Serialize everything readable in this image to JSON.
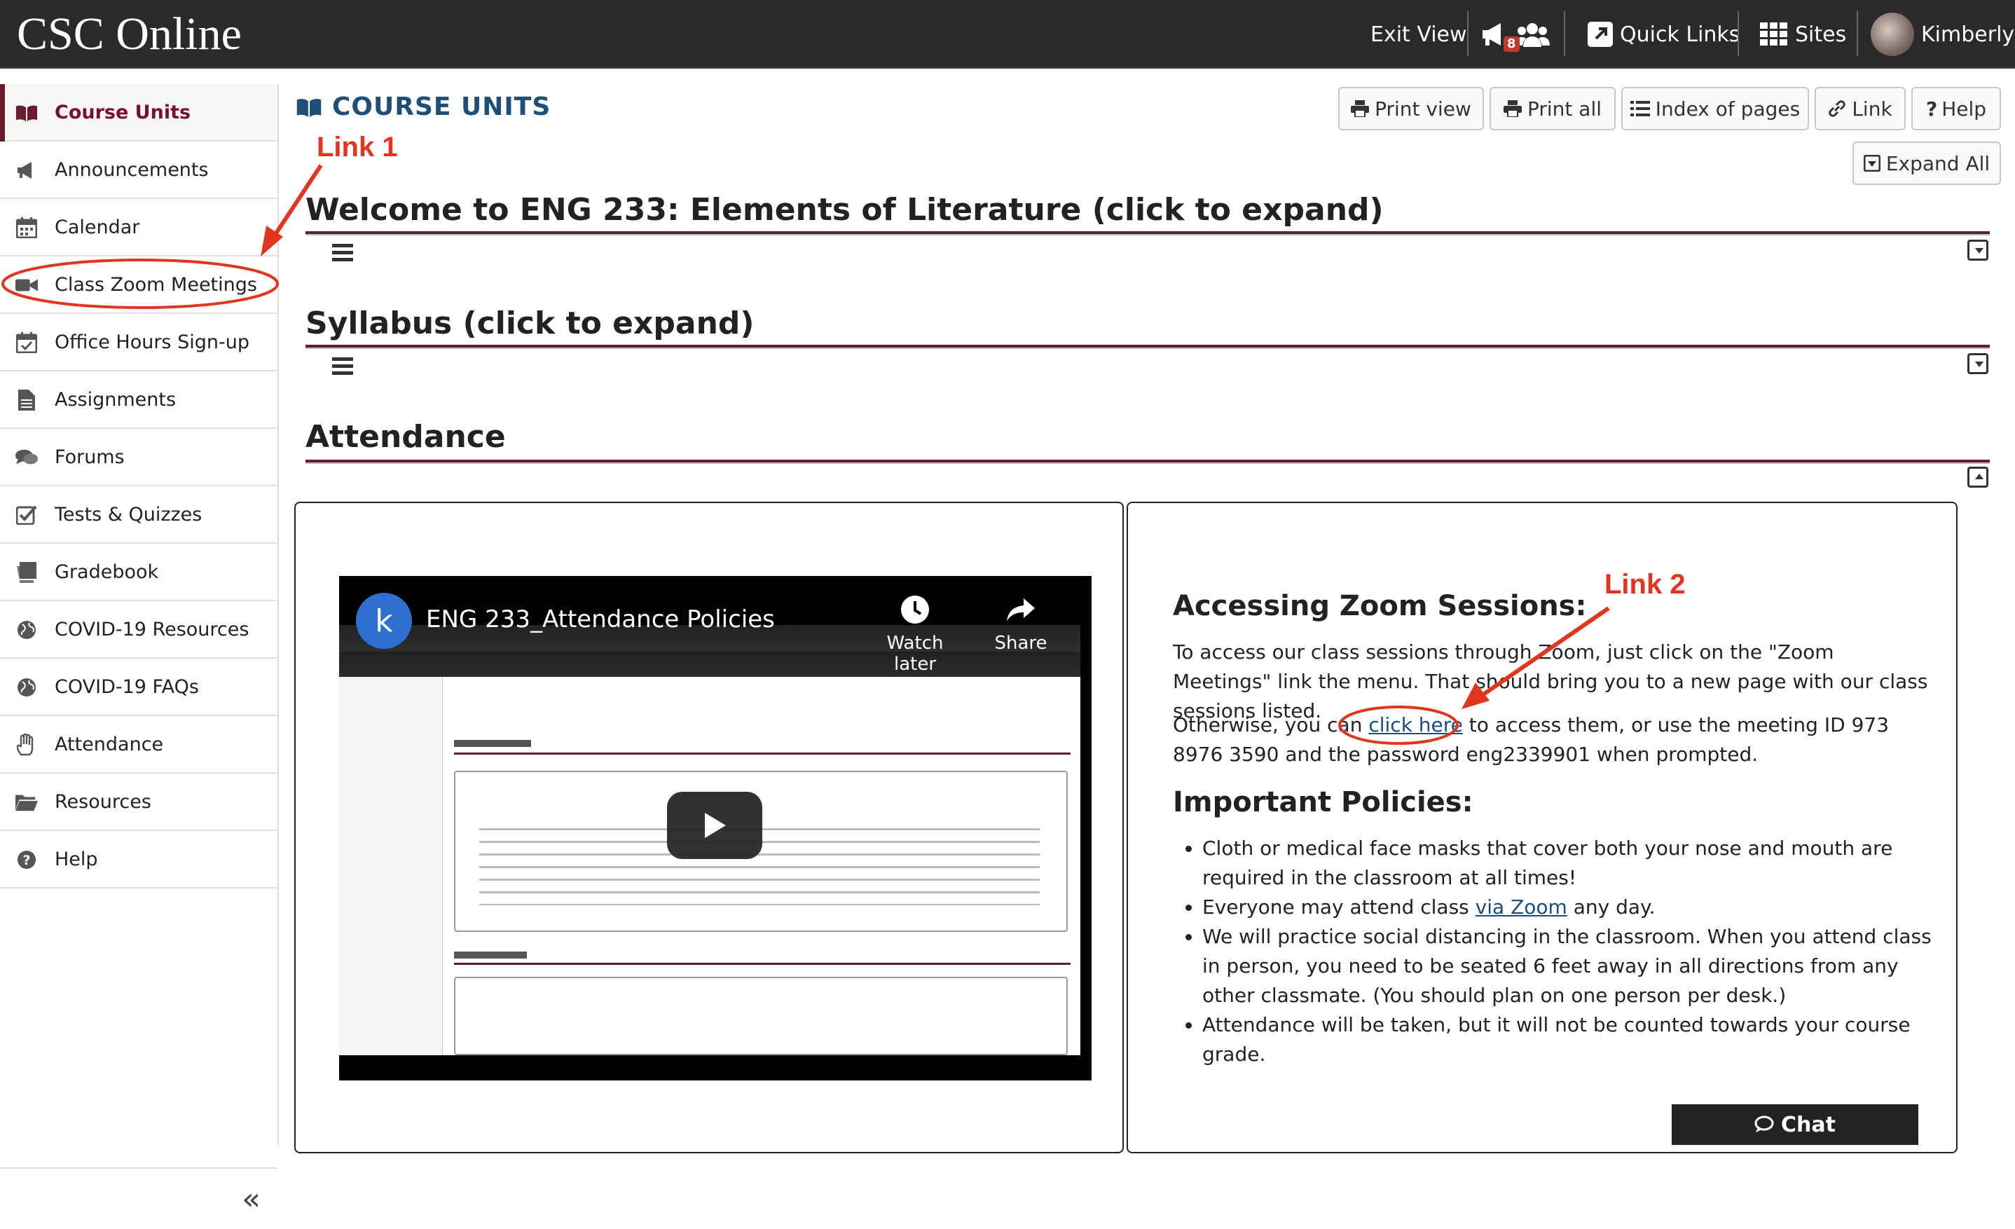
{
  "header": {
    "logo": "CSC Online",
    "exit_view": "Exit View",
    "notification_count": "8",
    "quick_links": "Quick Links",
    "sites": "Sites",
    "user_name": "Kimberly"
  },
  "sidebar": {
    "items": [
      {
        "label": "Course Units",
        "icon": "book-icon",
        "active": true
      },
      {
        "label": "Announcements",
        "icon": "megaphone-icon"
      },
      {
        "label": "Calendar",
        "icon": "calendar-icon"
      },
      {
        "label": "Class Zoom Meetings",
        "icon": "video-camera-icon"
      },
      {
        "label": "Office Hours Sign-up",
        "icon": "calendar-check-icon"
      },
      {
        "label": "Assignments",
        "icon": "file-icon"
      },
      {
        "label": "Forums",
        "icon": "comments-icon"
      },
      {
        "label": "Tests & Quizzes",
        "icon": "checkbox-icon"
      },
      {
        "label": "Gradebook",
        "icon": "gradebook-icon"
      },
      {
        "label": "COVID-19 Resources",
        "icon": "globe-icon"
      },
      {
        "label": "COVID-19 FAQs",
        "icon": "globe-icon"
      },
      {
        "label": "Attendance",
        "icon": "hand-icon"
      },
      {
        "label": "Resources",
        "icon": "folder-icon"
      },
      {
        "label": "Help",
        "icon": "question-icon"
      }
    ],
    "collapse_icon": "«"
  },
  "page": {
    "title": "COURSE UNITS",
    "toolbar": {
      "print_view": "Print view",
      "print_all": "Print all",
      "index_of_pages": "Index of pages",
      "link": "Link",
      "help": "Help",
      "expand_all": "Expand All"
    }
  },
  "sections": [
    {
      "title": "Welcome to ENG 233: Elements of Literature (click to expand)"
    },
    {
      "title": "Syllabus (click to expand)"
    },
    {
      "title": "Attendance"
    }
  ],
  "video": {
    "channel_initial": "k",
    "title": "ENG 233_Attendance Policies",
    "watch_later": "Watch later",
    "share": "Share"
  },
  "zoom_panel": {
    "heading": "Accessing Zoom Sessions:",
    "para1": "To access our class sessions through Zoom, just click on the \"Zoom Meetings\" link the menu. That should bring you to a new page with our class sessions listed.",
    "para2_pre": "Otherwise, you can ",
    "para2_link": "click here",
    "para2_post": " to access them, or use the meeting ID 973 8976 3590 and the password eng2339901 when prompted.",
    "policies_heading": "Important Policies:",
    "policy1": "Cloth or medical face masks that cover both your nose and mouth are required in the classroom at all times!",
    "policy2_pre": "Everyone may attend class ",
    "policy2_link": "via Zoom",
    "policy2_post": " any day.",
    "policy3": "We will practice social distancing in the classroom. When you attend class in person, you need to be seated 6 feet away in all directions from any other classmate. (You should plan on one person per desk.)",
    "policy4": "Attendance will be taken, but it will not be counted towards your course grade."
  },
  "chat": {
    "label": "Chat"
  },
  "annotations": {
    "link1": "Link 1",
    "link2": "Link 2"
  },
  "colors": {
    "maroon": "#6a1c2e",
    "annotation_red": "#e0361f",
    "link_blue": "#1a4d80"
  }
}
